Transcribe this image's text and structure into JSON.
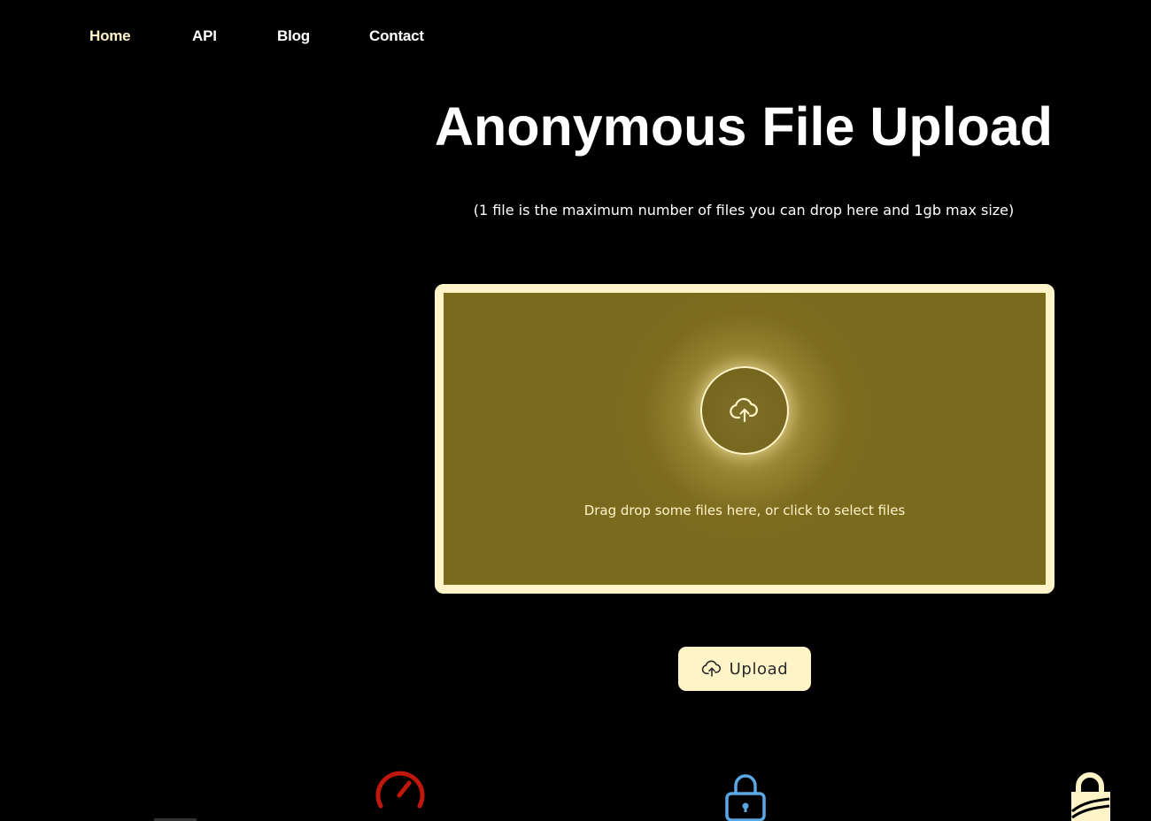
{
  "nav": {
    "home": "Home",
    "api": "API",
    "blog": "Blog",
    "contact": "Contact"
  },
  "main": {
    "title": "Anonymous File Upload",
    "subtitle": "(1 file is the maximum number of files you can drop here and 1gb max size)",
    "dropzone_text": "Drag drop some files here, or click to select files",
    "upload_label": "Upload"
  },
  "icons": {
    "dropzone": "cloud-upload-icon",
    "upload_button": "cloud-upload-icon",
    "features": [
      "speedometer-icon",
      "lock-icon",
      "privacy-lock-icon"
    ]
  },
  "colors": {
    "background": "#000000",
    "accent": "#fff3c8",
    "dropzone_fill": "#7a6a1d",
    "speed_icon": "#c0170d",
    "lock_icon": "#5aa7e6"
  }
}
